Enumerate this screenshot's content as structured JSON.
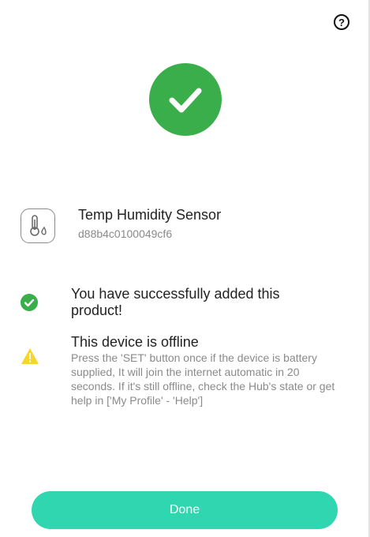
{
  "header": {
    "help_label": "?",
    "help_icon": "question-circle-icon"
  },
  "status": {
    "icon": "check-icon",
    "color": "#3aae4a"
  },
  "device": {
    "icon": "thermometer-humidity-icon",
    "name": "Temp Humidity Sensor",
    "id": "d88b4c0100049cf6"
  },
  "messages": {
    "success": {
      "icon": "check-circle-icon",
      "text": "You have successfully added this product!"
    },
    "offline": {
      "icon": "warning-icon",
      "title": "This device is offline",
      "body": "Press the 'SET' button once if the device is battery supplied, It will join the internet automatic in 20 seconds. If it's still offline, check the Hub's state or get help in ['My Profile' - 'Help']"
    }
  },
  "footer": {
    "done_label": "Done",
    "accent": "#30d6b0"
  }
}
